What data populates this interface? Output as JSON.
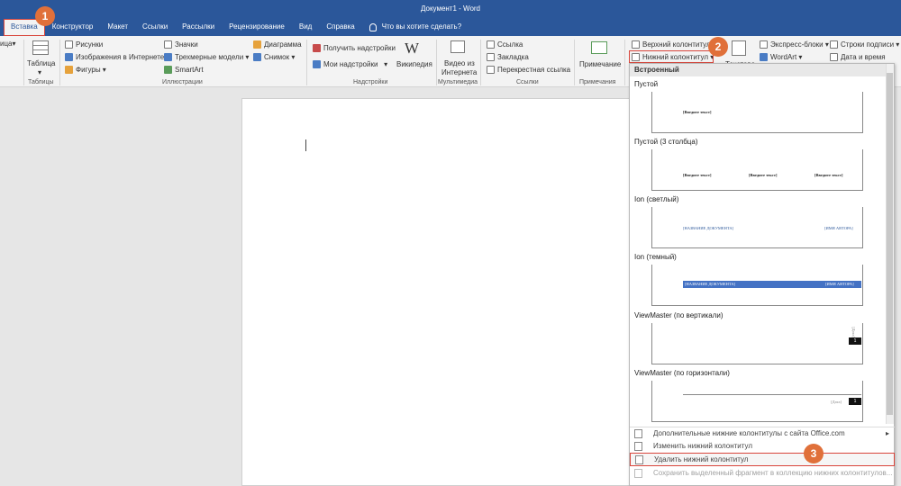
{
  "window": {
    "title": "Документ1  -  Word"
  },
  "tabs": [
    {
      "label": "Вставка",
      "active": true
    },
    {
      "label": "Конструктор"
    },
    {
      "label": "Макет"
    },
    {
      "label": "Ссылки"
    },
    {
      "label": "Рассылки"
    },
    {
      "label": "Рецензирование"
    },
    {
      "label": "Вид"
    },
    {
      "label": "Справка"
    }
  ],
  "tell_me": "Что вы хотите сделать?",
  "ribbon": {
    "pages_partial": "ица",
    "tables": {
      "button": "Таблица",
      "group": "Таблицы"
    },
    "illustrations": {
      "group": "Иллюстрации",
      "pictures": "Рисунки",
      "online_pictures": "Изображения в Интернете",
      "shapes": "Фигуры",
      "icons": "Значки",
      "models_3d": "Трехмерные модели",
      "smartart": "SmartArt",
      "chart": "Диаграмма",
      "screenshot": "Снимок"
    },
    "addins": {
      "group": "Надстройки",
      "get": "Получить надстройки",
      "my": "Мои надстройки",
      "wikipedia": "Википедия"
    },
    "media": {
      "group": "Мультимедиа",
      "online_video_1": "Видео из",
      "online_video_2": "Интернета"
    },
    "links": {
      "group": "Ссылки",
      "link": "Ссылка",
      "bookmark": "Закладка",
      "cross_ref": "Перекрестная ссылка"
    },
    "comments": {
      "group": "Примечания",
      "comment": "Примечание"
    },
    "header_footer": {
      "header": "Верхний колонтитул",
      "footer": "Нижний колонтитул",
      "textbox_partial": "Текстово"
    },
    "text": {
      "quick_parts": "Экспресс-блоки",
      "wordart": "WordArt",
      "signature": "Строки подписи",
      "datetime": "Дата и время"
    }
  },
  "gallery": {
    "header": "Встроенный",
    "items": [
      {
        "label": "Пустой"
      },
      {
        "label": "Пустой (3 столбца)"
      },
      {
        "label": "Ion (светлый)"
      },
      {
        "label": "Ion (темный)"
      },
      {
        "label": "ViewMaster (по вертикали)"
      },
      {
        "label": "ViewMaster (по горизонтали)"
      }
    ],
    "placeholder": "[Введите текст]",
    "ion_light_left": "[НАЗВАНИЕ ДОКУМЕНТА]",
    "ion_light_right": "[ИМЯ АВТОРА]",
    "ion_dark_left": "[НАЗВАНИЕ ДОКУМЕНТА]",
    "ion_dark_right": "[ИМЯ АВТОРА]",
    "vm_vertical_label": "[Дата]",
    "vm_horizontal_label": "[Дата]",
    "page_number": "1"
  },
  "menu": {
    "more": "Дополнительные нижние колонтитулы с сайта Office.com",
    "edit": "Изменить нижний колонтитул",
    "remove": "Удалить нижний колонтитул",
    "save": "Сохранить выделенный фрагмент в коллекцию нижних колонтитулов..."
  },
  "callouts": [
    "1",
    "2",
    "3"
  ],
  "colors": {
    "accent": "#2b579a",
    "highlight": "#d9453b",
    "callout": "#e0703a"
  }
}
